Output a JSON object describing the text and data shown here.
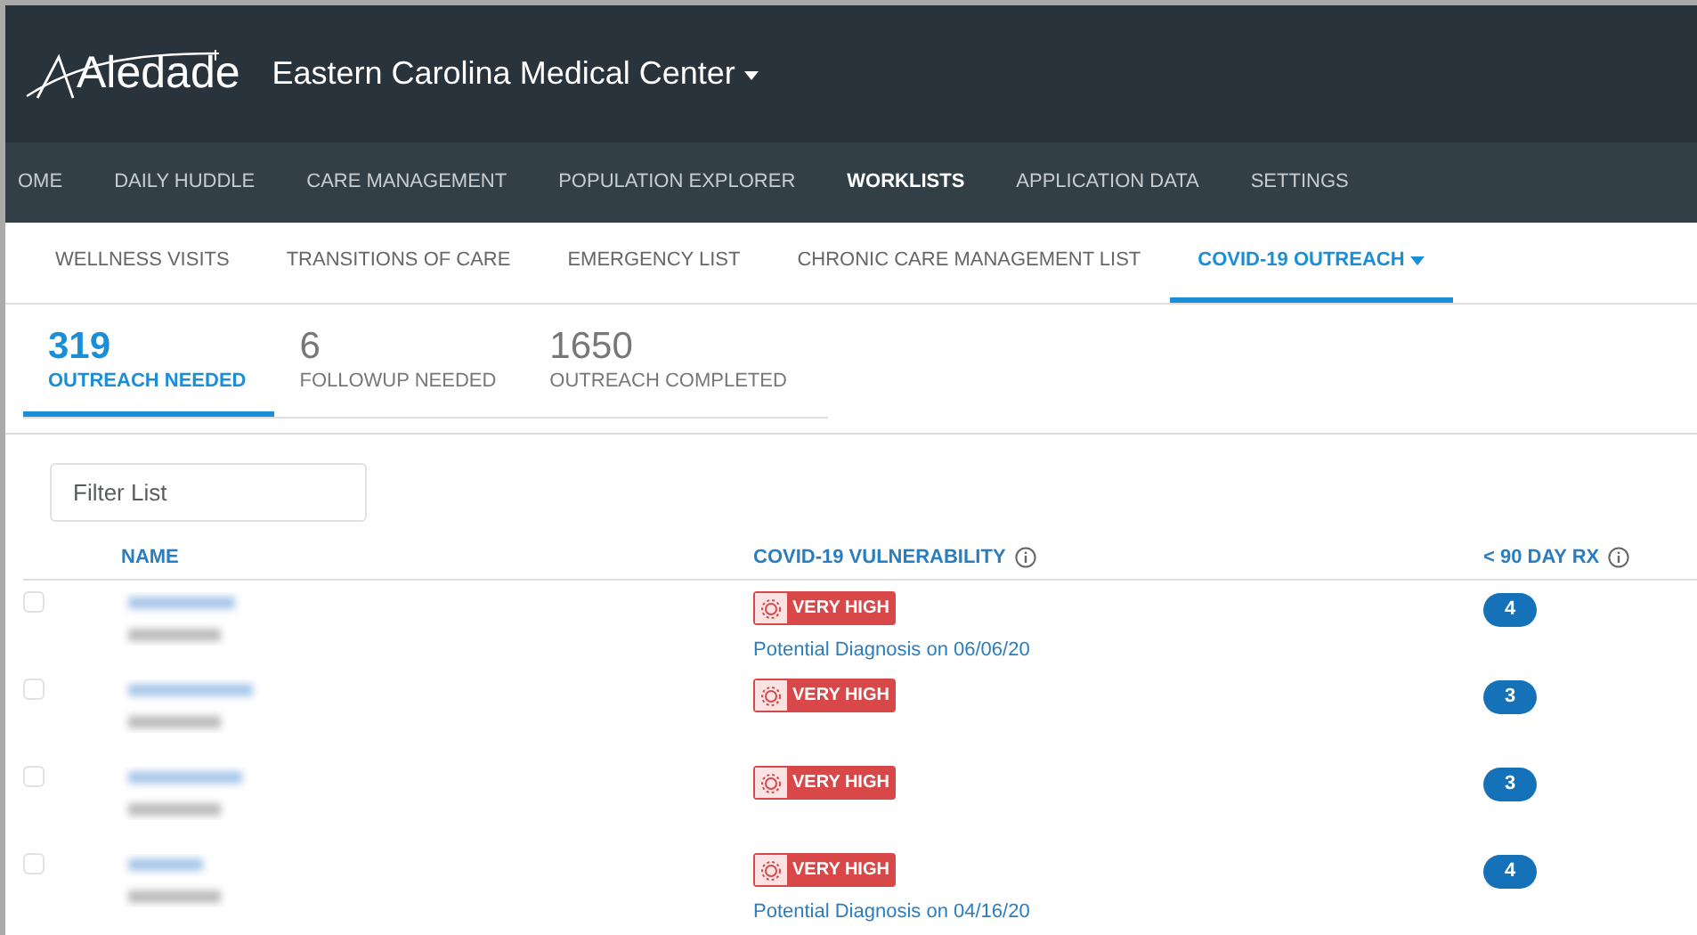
{
  "header": {
    "logo": "Aledade",
    "organization": "Eastern Carolina Medical Center"
  },
  "main_nav": [
    {
      "label": "OME",
      "selected": false
    },
    {
      "label": "DAILY HUDDLE",
      "selected": false
    },
    {
      "label": "CARE MANAGEMENT",
      "selected": false
    },
    {
      "label": "POPULATION EXPLORER",
      "selected": false
    },
    {
      "label": "WORKLISTS",
      "selected": true
    },
    {
      "label": "APPLICATION DATA",
      "selected": false
    },
    {
      "label": "SETTINGS",
      "selected": false
    }
  ],
  "worklist_tabs": [
    {
      "label": "WELLNESS VISITS",
      "selected": false,
      "dropdown": false
    },
    {
      "label": "TRANSITIONS OF CARE",
      "selected": false,
      "dropdown": false
    },
    {
      "label": "EMERGENCY LIST",
      "selected": false,
      "dropdown": false
    },
    {
      "label": "CHRONIC CARE MANAGEMENT LIST",
      "selected": false,
      "dropdown": false
    },
    {
      "label": "COVID-19 OUTREACH",
      "selected": true,
      "dropdown": true
    }
  ],
  "stat_tabs": [
    {
      "count": "319",
      "label": "OUTREACH NEEDED",
      "selected": true
    },
    {
      "count": "6",
      "label": "FOLLOWUP NEEDED",
      "selected": false
    },
    {
      "count": "1650",
      "label": "OUTREACH COMPLETED",
      "selected": false
    }
  ],
  "filter": {
    "placeholder": "Filter List"
  },
  "table": {
    "columns": [
      "NAME",
      "COVID-19 VULNERABILITY",
      "< 90 DAY RX"
    ],
    "rows": [
      {
        "checked": false,
        "vulnerability": "VERY HIGH",
        "diagnosis": "Potential Diagnosis on 06/06/20",
        "rx": "4"
      },
      {
        "checked": false,
        "vulnerability": "VERY HIGH",
        "rx": "3"
      },
      {
        "checked": false,
        "vulnerability": "VERY HIGH",
        "rx": "3"
      },
      {
        "checked": false,
        "vulnerability": "VERY HIGH",
        "diagnosis": "Potential Diagnosis on 04/16/20",
        "rx": "4"
      }
    ]
  }
}
